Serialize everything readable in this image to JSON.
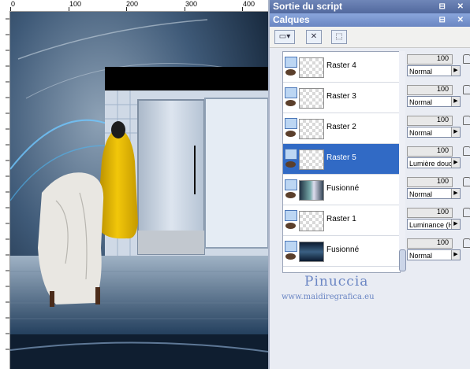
{
  "ruler": {
    "marks": [
      "0",
      "100",
      "200",
      "300",
      "400"
    ]
  },
  "panels": {
    "script_output": {
      "title": "Sortie du script"
    },
    "layers": {
      "title": "Calques"
    }
  },
  "layers": [
    {
      "name": "Raster 4",
      "opacity": "100",
      "blend": "Normal",
      "selected": false
    },
    {
      "name": "Raster 3",
      "opacity": "100",
      "blend": "Normal",
      "selected": false
    },
    {
      "name": "Raster 2",
      "opacity": "100",
      "blend": "Normal",
      "selected": false
    },
    {
      "name": "Raster 5",
      "opacity": "100",
      "blend": "Lumière douce",
      "selected": true
    },
    {
      "name": "Fusionné",
      "opacity": "100",
      "blend": "Normal",
      "selected": false
    },
    {
      "name": "Raster 1",
      "opacity": "100",
      "blend": "Luminance (H)",
      "selected": false
    },
    {
      "name": "Fusionné",
      "opacity": "100",
      "blend": "Normal",
      "selected": false
    }
  ],
  "credit": {
    "name": "Pinuccia",
    "url": "www.maidiregrafica.eu"
  },
  "colors": {
    "selection": "#316ac5",
    "title_bar": "#6a86c2",
    "credit_text": "#6b86c4"
  },
  "icons": [
    "new-layer-icon",
    "delete-layer-icon",
    "mask-icon",
    "eye-icon",
    "lock-icon",
    "pin-icon",
    "close-icon"
  ]
}
